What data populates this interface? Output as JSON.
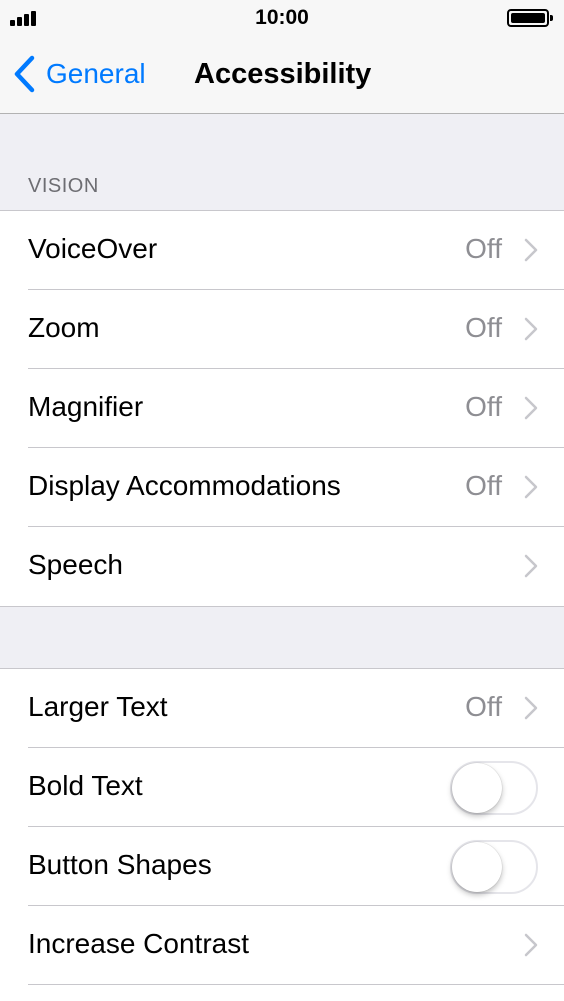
{
  "status_bar": {
    "time": "10:00"
  },
  "nav": {
    "back_label": "General",
    "title": "Accessibility"
  },
  "vision_section": {
    "header": "VISION",
    "rows": [
      {
        "label": "VoiceOver",
        "value": "Off"
      },
      {
        "label": "Zoom",
        "value": "Off"
      },
      {
        "label": "Magnifier",
        "value": "Off"
      },
      {
        "label": "Display Accommodations",
        "value": "Off"
      },
      {
        "label": "Speech",
        "value": ""
      }
    ]
  },
  "text_section": {
    "rows": [
      {
        "label": "Larger Text",
        "value": "Off",
        "control": "chevron"
      },
      {
        "label": "Bold Text",
        "control": "toggle",
        "on": false
      },
      {
        "label": "Button Shapes",
        "control": "toggle",
        "on": false
      },
      {
        "label": "Increase Contrast",
        "control": "chevron"
      }
    ]
  },
  "colors": {
    "accent": "#007aff",
    "secondary_text": "#8e8e93",
    "background": "#efeff4"
  },
  "icons": [
    "cellular-signal-icon",
    "battery-icon",
    "chevron-left-icon",
    "chevron-right-icon"
  ]
}
